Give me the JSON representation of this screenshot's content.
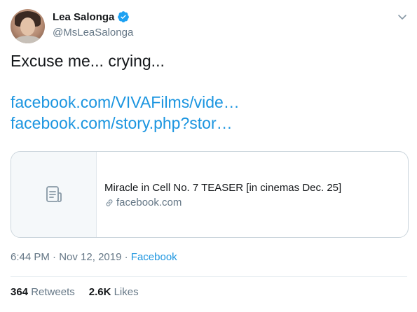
{
  "author": {
    "display_name": "Lea Salonga",
    "handle": "@MsLeaSalonga",
    "verified": true,
    "avatar": "profile-photo"
  },
  "tweet": {
    "text": "Excuse me... crying...",
    "links": [
      "facebook.com/VIVAFilms/vide…",
      "facebook.com/story.php?stor…"
    ]
  },
  "card": {
    "title": "Miracle in Cell No. 7 TEASER [in cinemas Dec. 25]",
    "domain": "facebook.com",
    "thumb_icon": "document-icon",
    "domain_icon": "link-icon"
  },
  "meta": {
    "time": "6:44 PM",
    "date": "Nov 12, 2019",
    "separator": "·",
    "source": "Facebook"
  },
  "stats": {
    "retweets_count": "364",
    "retweets_label": "Retweets",
    "likes_count": "2.6K",
    "likes_label": "Likes"
  },
  "colors": {
    "link": "#1b95e0",
    "secondary_text": "#657786",
    "verified": "#1da1f2",
    "border": "#ccd6dd"
  }
}
